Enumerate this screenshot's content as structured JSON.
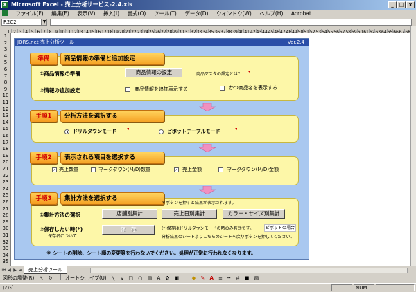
{
  "window": {
    "title": "Microsoft Excel - 売上分析サービス-2.4.xls",
    "minimize": "_",
    "maximize": "□",
    "close": "x"
  },
  "menu": [
    "ファイル(F)",
    "編集(E)",
    "表示(V)",
    "挿入(I)",
    "書式(O)",
    "ツール(T)",
    "データ(D)",
    "ウィンドウ(W)",
    "ヘルプ(H)",
    "Acrobat"
  ],
  "formula": {
    "namebox": "R2C2"
  },
  "columns": [
    "1",
    "2",
    "3",
    "4",
    "5",
    "6",
    "7",
    "8",
    "9",
    "10",
    "11",
    "12",
    "13",
    "14",
    "15",
    "16",
    "17",
    "18",
    "19",
    "20",
    "21",
    "22",
    "23",
    "24",
    "25",
    "26",
    "27",
    "28",
    "29",
    "30",
    "31",
    "32",
    "33",
    "34",
    "35",
    "36",
    "37",
    "38",
    "39",
    "40",
    "41",
    "42",
    "43",
    "44",
    "45",
    "46",
    "47",
    "48",
    "49",
    "50",
    "51",
    "52",
    "53",
    "54",
    "55",
    "56",
    "57",
    "58",
    "59",
    "60",
    "61",
    "62",
    "63",
    "64",
    "65",
    "66",
    "67",
    "68"
  ],
  "rows": [
    "1",
    "2",
    "3",
    "4",
    "5",
    "6",
    "7",
    "8",
    "9",
    "10",
    "11",
    "12",
    "13",
    "14",
    "15",
    "16",
    "17",
    "18",
    "19",
    "20",
    "21",
    "22",
    "23",
    "24",
    "25",
    "26",
    "27",
    "28",
    "29",
    "30",
    "31",
    "32",
    "33",
    "34",
    "35"
  ],
  "tool": {
    "title": "JQRS.net 売上分析ツール",
    "version": "Ver.2.4",
    "prep": {
      "step": "準備",
      "heading": "商品情報の準備と追加設定",
      "item1": "①商品情報の準備",
      "button": "商品情報の設定",
      "hint": "商品マスタの設定とは？",
      "item2": "②情報の追加設定",
      "check1": "商品情報を追加表示する",
      "check2": "かつ商品名を表示する"
    },
    "step1": {
      "step": "手順1",
      "heading": "分析方法を選択する",
      "radio1": "ドリルダウンモード",
      "radio2": "ピボットテーブルモード"
    },
    "step2": {
      "step": "手順2",
      "heading": "表示される項目を選択する",
      "check1": "売上数量",
      "check2": "マークダウン(M/D)数量",
      "check3": "売上金額",
      "check4": "マークダウン(M/D)金額"
    },
    "step3": {
      "step": "手順3",
      "heading": "集計方法を選択する",
      "note": "＊ボタンを押すと結果が表示されます。",
      "item1": "①集計方法の選択",
      "btn1": "店舗別集計",
      "btn2": "売上日別集計",
      "btn3": "カラー・サイズ別集計",
      "item2": "②保存したい時(*)",
      "save_about": "保存名について",
      "save_btn": "保　存",
      "save_note1": "(*)保存はドリルダウンモードの時のみ有効です。",
      "save_note_link": "ピボットの場合",
      "save_note2": "分析結果のシートよりこちらのシートへ戻りボタンを押してください。"
    },
    "warning": "※ シートの削除、シート順の変更等を行わないでください。処理が正常に行われなくなります。"
  },
  "sheet_tab": "売上分析ツール",
  "drawbar": {
    "draw": "図形の調整(R)",
    "autoshape": "オートシェイプ(U)"
  },
  "status": {
    "left": "ｺﾏﾝﾄﾞ",
    "num": "NUM"
  },
  "colors": {
    "accent": "#f5a224",
    "panel": "#fdf7a8",
    "tool_bg": "#a9c8f0",
    "arrow": "#f090c0"
  }
}
